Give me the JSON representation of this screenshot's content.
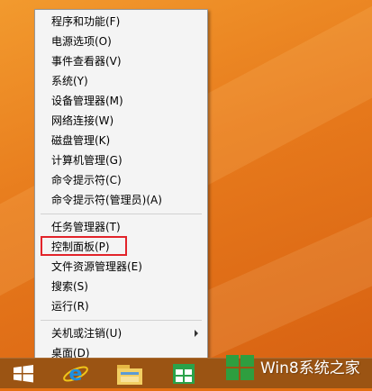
{
  "menu": {
    "items": [
      {
        "label": "程序和功能(F)"
      },
      {
        "label": "电源选项(O)"
      },
      {
        "label": "事件查看器(V)"
      },
      {
        "label": "系统(Y)"
      },
      {
        "label": "设备管理器(M)"
      },
      {
        "label": "网络连接(W)"
      },
      {
        "label": "磁盘管理(K)"
      },
      {
        "label": "计算机管理(G)"
      },
      {
        "label": "命令提示符(C)"
      },
      {
        "label": "命令提示符(管理员)(A)"
      },
      {
        "label": "任务管理器(T)"
      },
      {
        "label": "控制面板(P)",
        "highlighted": true
      },
      {
        "label": "文件资源管理器(E)"
      },
      {
        "label": "搜索(S)"
      },
      {
        "label": "运行(R)"
      },
      {
        "label": "关机或注销(U)",
        "has_submenu": true
      },
      {
        "label": "桌面(D)"
      }
    ],
    "highlight_color": "#e2232a"
  },
  "taskbar": {
    "buttons": [
      {
        "name": "start-icon"
      },
      {
        "name": "internet-explorer-icon"
      },
      {
        "name": "file-explorer-icon"
      },
      {
        "name": "store-icon"
      }
    ],
    "color": "#9b5413"
  },
  "watermark": {
    "text": "Win8系统之家"
  }
}
